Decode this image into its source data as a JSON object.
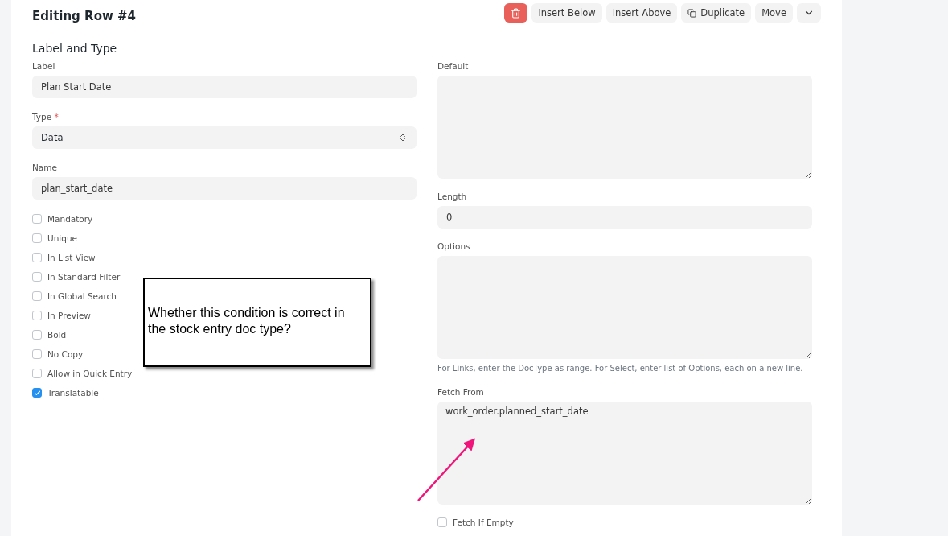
{
  "header": {
    "title": "Editing Row #4",
    "actions": [
      {
        "kind": "delete"
      },
      {
        "kind": "text",
        "label": "Insert Below"
      },
      {
        "kind": "text",
        "label": "Insert Above"
      },
      {
        "kind": "duplicate",
        "label": "Duplicate"
      },
      {
        "kind": "text",
        "label": "Move"
      },
      {
        "kind": "more"
      }
    ]
  },
  "section_title": "Label and Type",
  "left_fields": [
    {
      "kind": "input",
      "label": "Label",
      "value": "Plan Start Date"
    },
    {
      "kind": "select",
      "label": "Type",
      "required_mark": "*",
      "value": "Data"
    },
    {
      "kind": "input",
      "label": "Name",
      "value": "plan_start_date"
    }
  ],
  "checkboxes": [
    {
      "label": "Mandatory",
      "checked": false
    },
    {
      "label": "Unique",
      "checked": false
    },
    {
      "label": "In List View",
      "checked": false
    },
    {
      "label": "In Standard Filter",
      "checked": false
    },
    {
      "label": "In Global Search",
      "checked": false
    },
    {
      "label": "In Preview",
      "checked": false
    },
    {
      "label": "Bold",
      "checked": false
    },
    {
      "label": "No Copy",
      "checked": false
    },
    {
      "label": "Allow in Quick Entry",
      "checked": false
    },
    {
      "label": "Translatable",
      "checked": true
    }
  ],
  "right_fields": [
    {
      "kind": "textarea",
      "label": "Default"
    },
    {
      "kind": "input",
      "label": "Length",
      "value": "0"
    },
    {
      "kind": "textarea",
      "label": "Options",
      "description": "For Links, enter the DocType as range. For Select, enter list of Options, each on a new line."
    },
    {
      "kind": "textarea",
      "label": "Fetch From",
      "value": "work_order.planned_start_date"
    }
  ],
  "right_checkboxes": [
    {
      "label": "Fetch If Empty",
      "checked": false
    }
  ],
  "callout": {
    "text": "Whether this condition is correct in the stock entry doc type?"
  }
}
